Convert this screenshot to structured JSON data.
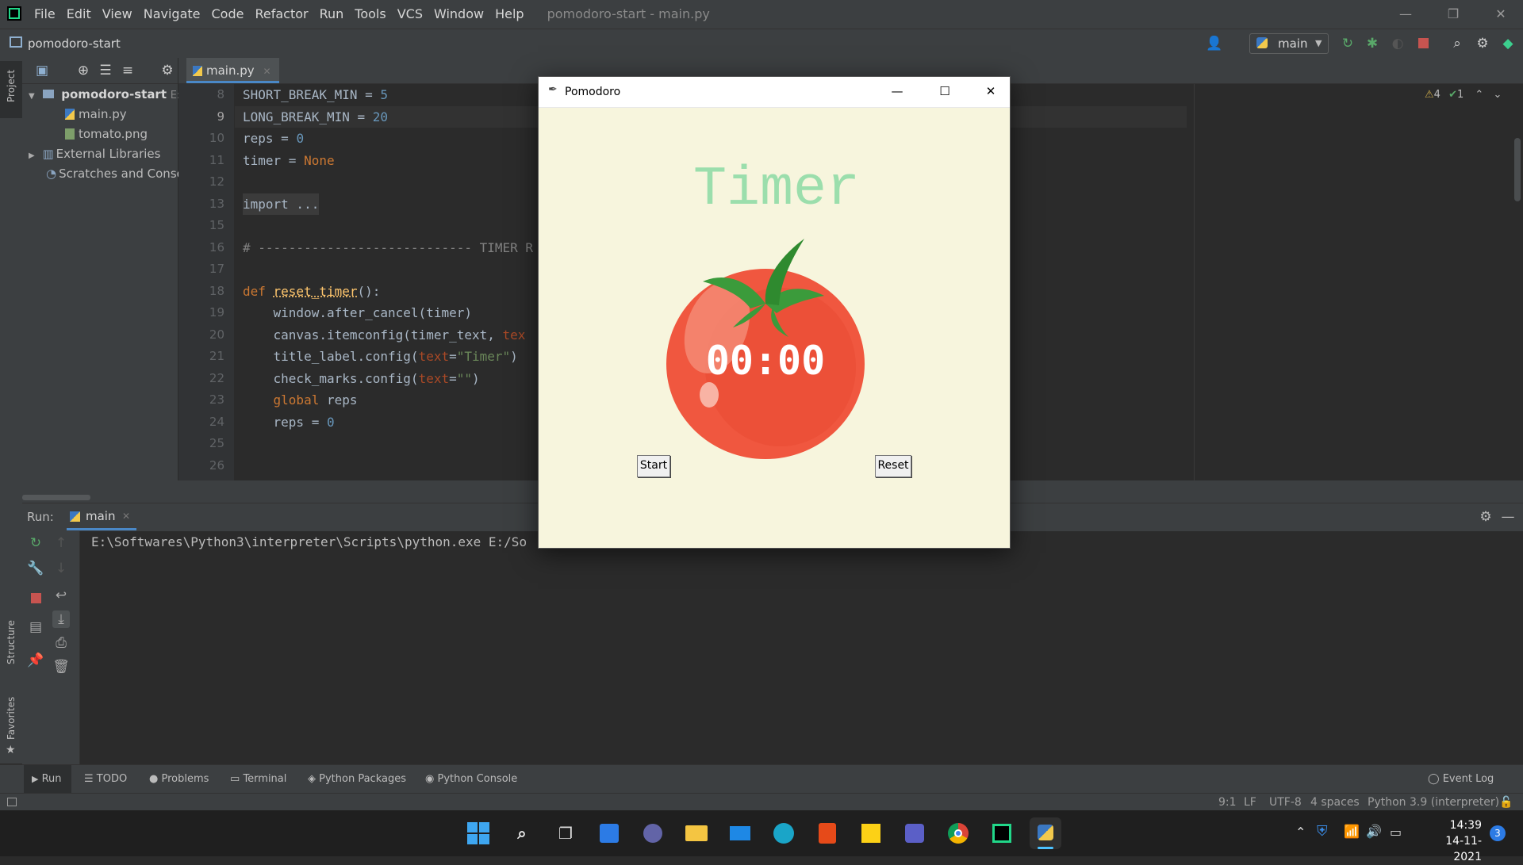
{
  "menubar": {
    "items": [
      "File",
      "Edit",
      "View",
      "Navigate",
      "Code",
      "Refactor",
      "Run",
      "Tools",
      "VCS",
      "Window",
      "Help"
    ],
    "window_title": "pomodoro-start - main.py"
  },
  "navbar": {
    "project": "pomodoro-start",
    "run_config": "main"
  },
  "left_strip": {
    "project": "Project",
    "structure": "Structure",
    "favorites": "Favorites"
  },
  "project_tree": {
    "root": "pomodoro-start",
    "root_path": "E:\\S",
    "files": [
      "main.py",
      "tomato.png"
    ],
    "external": "External Libraries",
    "scratches": "Scratches and Consoles"
  },
  "editor": {
    "tab": "main.py",
    "inspection": {
      "warnings": "4",
      "ok": "1"
    },
    "line_numbers": [
      "8",
      "9",
      "10",
      "11",
      "12",
      "13",
      "15",
      "16",
      "17",
      "18",
      "19",
      "20",
      "21",
      "22",
      "23",
      "24",
      "25",
      "26"
    ]
  },
  "code": {
    "l8a": "SHORT_BREAK_MIN = ",
    "l8b": "5",
    "l9a": "LONG_BREAK_MIN = ",
    "l9b": "20",
    "l10a": "reps = ",
    "l10b": "0",
    "l11a": "timer = ",
    "l11b": "None",
    "l13": "import ...",
    "l16": "# ---------------------------- TIMER R",
    "l18a": "def ",
    "l18b": "reset_timer",
    "l18c": "():",
    "l19": "    window.after_cancel(timer)",
    "l20a": "    canvas.itemconfig(timer_text, ",
    "l20b": "tex",
    "l21a": "    title_label.config(",
    "l21b": "text",
    "l21c": "=",
    "l21d": "\"Timer\"",
    "l21e": ")",
    "l22a": "    check_marks.config(",
    "l22b": "text",
    "l22c": "=",
    "l22d": "\"\"",
    "l22e": ")",
    "l23a": "    ",
    "l23b": "global",
    "l23c": " reps",
    "l24a": "    reps = ",
    "l24b": "0"
  },
  "run_panel": {
    "label": "Run:",
    "tab": "main",
    "output": "E:\\Softwares\\Python3\\interpreter\\Scripts\\python.exe E:/So"
  },
  "bottom_tools": [
    "Run",
    "TODO",
    "Problems",
    "Terminal",
    "Python Packages",
    "Python Console"
  ],
  "event_log": "Event Log",
  "status": {
    "position": "9:1",
    "line_sep": "LF",
    "encoding": "UTF-8",
    "indent": "4 spaces",
    "interpreter": "Python 3.9 (interpreter)"
  },
  "pomodoro": {
    "window_title": "Pomodoro",
    "title_label": "Timer",
    "timer_text": "00:00",
    "start": "Start",
    "reset": "Reset",
    "colors": {
      "background": "#f7f5dd",
      "title": "#9bdeac",
      "tomato": "#f0573f",
      "leaf": "#3b9b3b"
    }
  },
  "taskbar": {
    "time": "14:39",
    "date": "14-11-2021",
    "notifications": "3"
  }
}
